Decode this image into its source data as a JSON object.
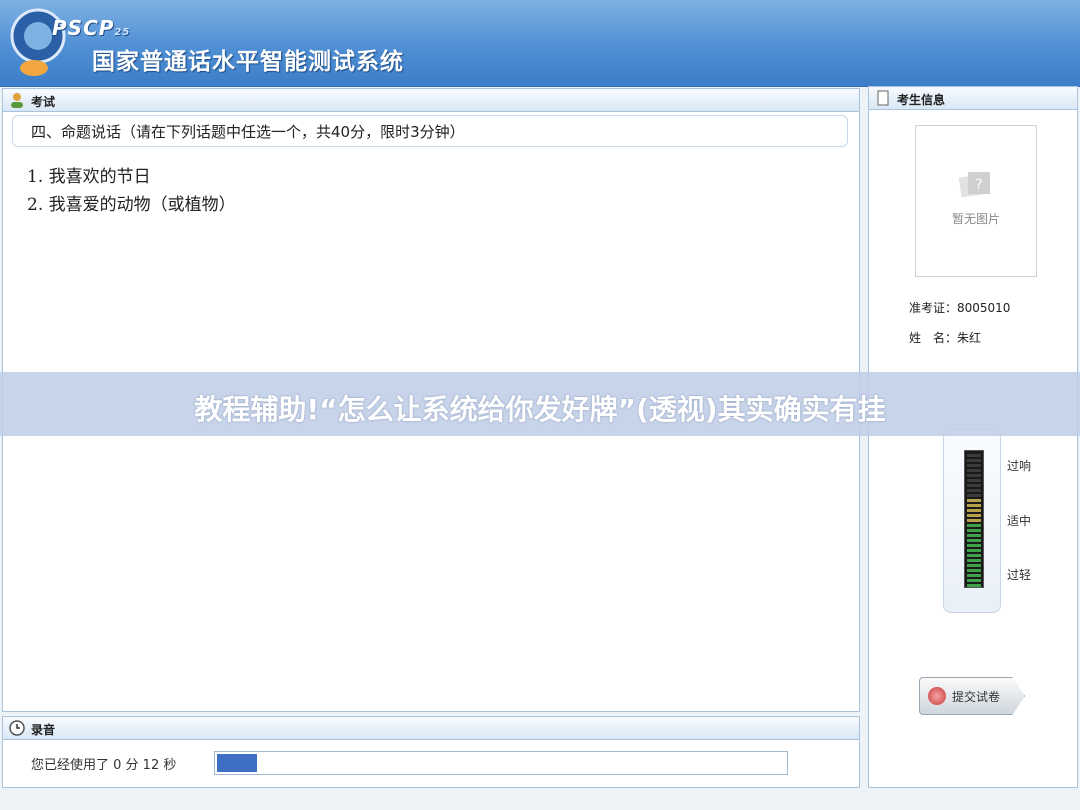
{
  "header": {
    "logo_text": "PSCP",
    "logo_sup": "25",
    "title": "国家普通话水平智能测试系统"
  },
  "exam": {
    "panel_title": "考试",
    "topic": "四、命题说话（请在下列话题中任选一个，共40分，限时3分钟）",
    "items": [
      "1. 我喜欢的节日",
      "2. 我喜爱的动物（或植物）"
    ]
  },
  "record": {
    "panel_title": "录音",
    "used_text": "您已经使用了 0  分 12 秒",
    "progress_fraction": 0.07
  },
  "candidate": {
    "panel_title": "考生信息",
    "photo_placeholder": "暂无图片",
    "id_label": "准考证：8005010",
    "name_label": "姓　名：朱红"
  },
  "volume": {
    "labels": [
      "过响",
      "适中",
      "过轻"
    ]
  },
  "submit_label": "提交试卷",
  "banner_text": "教程辅助!“怎么让系统给你发好牌”(透视)其实确实有挂",
  "colors": {
    "header": "#4f8fd4",
    "progress": "#3e6fc5",
    "banner": "#becde6"
  }
}
